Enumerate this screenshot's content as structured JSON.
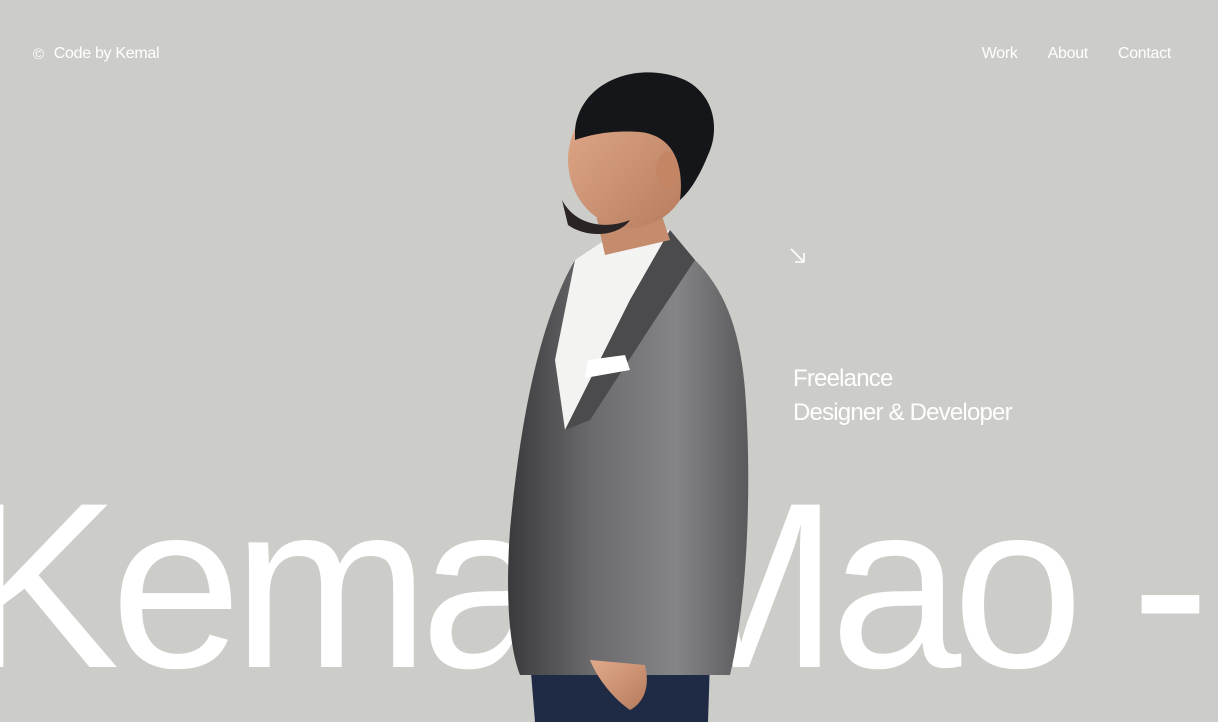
{
  "header": {
    "copyright_symbol": "©",
    "brand": "Code by Kemal",
    "nav": [
      {
        "label": "Work"
      },
      {
        "label": "About"
      },
      {
        "label": "Contact"
      }
    ]
  },
  "hero": {
    "arrow_icon": "arrow-down-right-icon",
    "role_line1": "Freelance",
    "role_line2": "Designer & Developer",
    "marquee_text": "Kemal Mao -"
  },
  "colors": {
    "background": "#cccdc9",
    "text": "#ffffff"
  }
}
